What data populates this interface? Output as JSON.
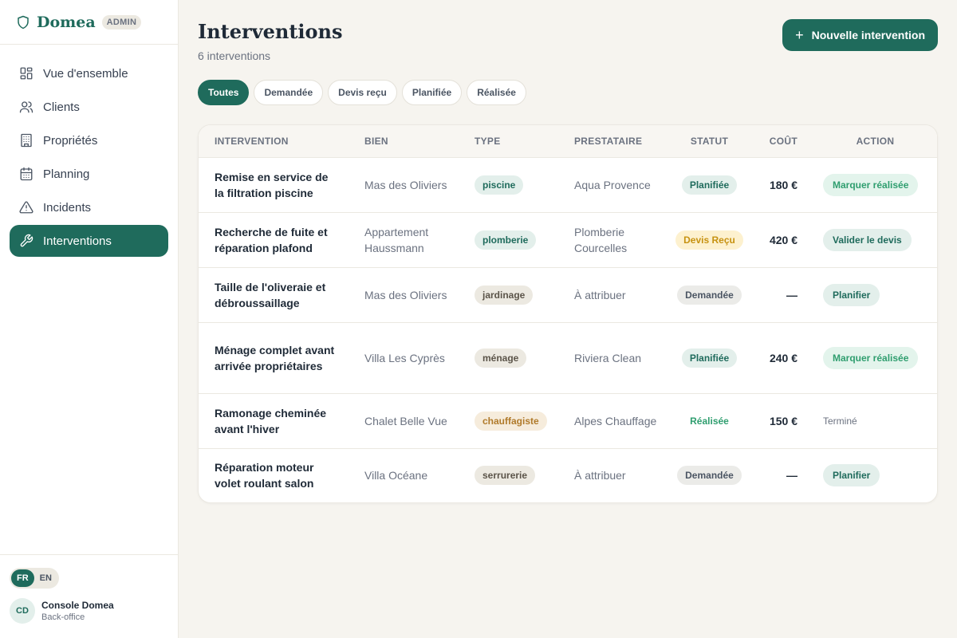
{
  "brand": {
    "name": "Domea",
    "badge": "ADMIN"
  },
  "nav": [
    {
      "label": "Vue d'ensemble",
      "icon": "grid-icon",
      "active": false
    },
    {
      "label": "Clients",
      "icon": "users-icon",
      "active": false
    },
    {
      "label": "Propriétés",
      "icon": "building-icon",
      "active": false
    },
    {
      "label": "Planning",
      "icon": "calendar-icon",
      "active": false
    },
    {
      "label": "Incidents",
      "icon": "alert-triangle-icon",
      "active": false
    },
    {
      "label": "Interventions",
      "icon": "wrench-icon",
      "active": true
    }
  ],
  "lang": {
    "options": [
      "FR",
      "EN"
    ],
    "active": "FR"
  },
  "user": {
    "initials": "CD",
    "name": "Console Domea",
    "role": "Back-office"
  },
  "header": {
    "title": "Interventions",
    "subtitle": "6 interventions",
    "new_button": "Nouvelle intervention"
  },
  "filters": [
    {
      "label": "Toutes",
      "active": true
    },
    {
      "label": "Demandée",
      "active": false
    },
    {
      "label": "Devis reçu",
      "active": false
    },
    {
      "label": "Planifiée",
      "active": false
    },
    {
      "label": "Réalisée",
      "active": false
    }
  ],
  "table": {
    "columns": [
      "INTERVENTION",
      "BIEN",
      "TYPE",
      "PRESTATAIRE",
      "STATUT",
      "COÛT",
      "ACTION"
    ],
    "rows": [
      {
        "title": "Remise en service de la filtration piscine",
        "bien": "Mas des Oliviers",
        "type": "piscine",
        "type_style": "green",
        "prestataire": "Aqua Provence",
        "status": "Planifiée",
        "status_style": "planned",
        "cost": "180 €",
        "action": "Marquer réalisée",
        "action_style": "light-green"
      },
      {
        "title": "Recherche de fuite et réparation plafond",
        "bien": "Appartement Haussmann",
        "type": "plomberie",
        "type_style": "green",
        "prestataire": "Plomberie Courcelles",
        "status": "Devis Reçu",
        "status_style": "quote",
        "cost": "420 €",
        "action": "Valider le devis",
        "action_style": "teal"
      },
      {
        "title": "Taille de l'oliveraie et débroussaillage",
        "bien": "Mas des Oliviers",
        "type": "jardinage",
        "type_style": "beige",
        "prestataire": "À attribuer",
        "status": "Demandée",
        "status_style": "requested",
        "cost": "—",
        "action": "Planifier",
        "action_style": "teal"
      },
      {
        "title": "Ménage complet avant arrivée propriétaires",
        "bien": "Villa Les Cyprès",
        "type": "ménage",
        "type_style": "beige",
        "prestataire": "Riviera Clean",
        "status": "Planifiée",
        "status_style": "planned",
        "cost": "240 €",
        "action": "Marquer réalisée",
        "action_style": "light-green"
      },
      {
        "title": "Ramonage cheminée avant l'hiver",
        "bien": "Chalet Belle Vue",
        "type": "chauffagiste",
        "type_style": "orange",
        "prestataire": "Alpes Chauffage",
        "status": "Réalisée",
        "status_style": "done",
        "cost": "150 €",
        "action": "Terminé",
        "action_style": "text"
      },
      {
        "title": "Réparation moteur volet roulant salon",
        "bien": "Villa Océane",
        "type": "serrurerie",
        "type_style": "beige",
        "prestataire": "À attribuer",
        "status": "Demandée",
        "status_style": "requested",
        "cost": "—",
        "action": "Planifier",
        "action_style": "teal"
      }
    ]
  },
  "colors": {
    "primary": "#1f6b5c",
    "background": "#f6f4ef",
    "tag_green_bg": "#e3efeb",
    "tag_green_fg": "#1f6b5c",
    "tag_beige_bg": "#ece9e1",
    "tag_beige_fg": "#5b5449",
    "tag_orange_bg": "#f6ecdc",
    "tag_orange_fg": "#b07a2a",
    "status_planned_bg": "#e3efeb",
    "status_planned_fg": "#1f6b5c",
    "status_quote_bg": "#fdf1cf",
    "status_quote_fg": "#c79211",
    "status_requested_bg": "#ebebe8",
    "status_requested_fg": "#4b5563",
    "status_done_fg": "#2f9e6f",
    "action_light_green_bg": "#e3f4ec",
    "action_light_green_fg": "#2f9e6f",
    "action_teal_bg": "#e3efeb",
    "action_teal_fg": "#1f6b5c"
  }
}
